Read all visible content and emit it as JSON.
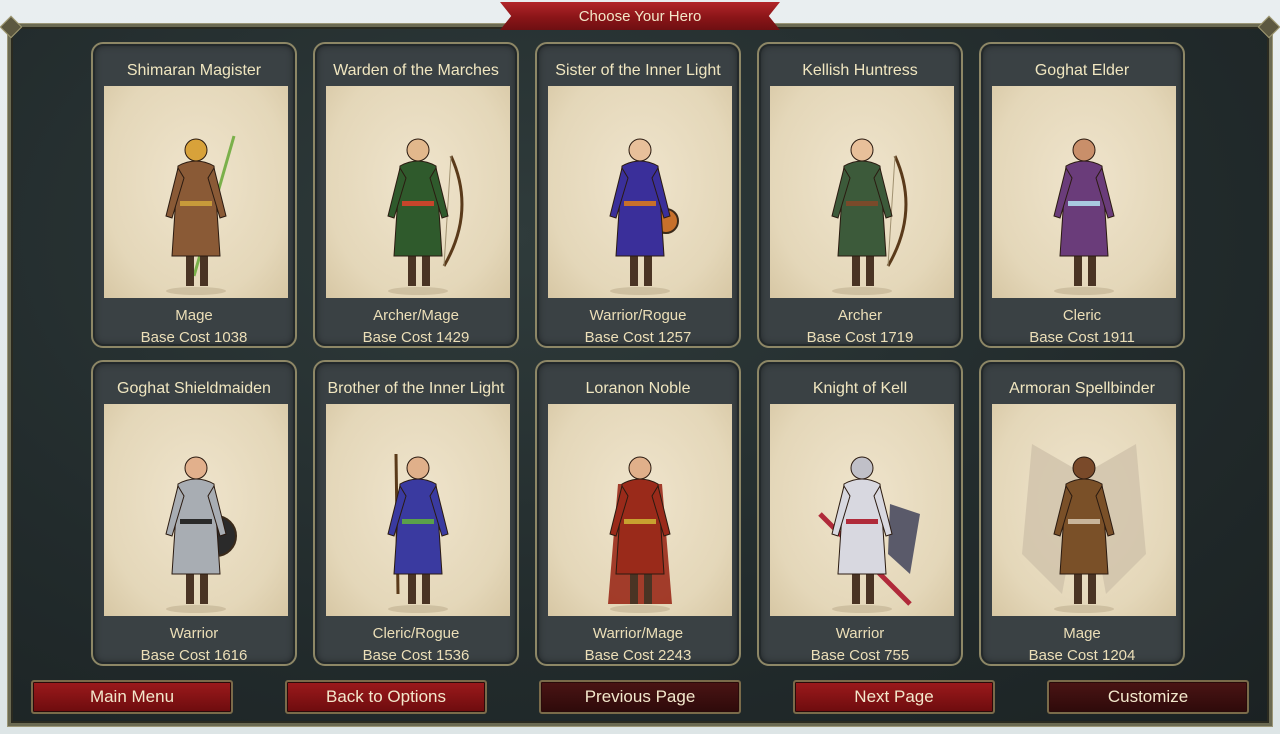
{
  "header": {
    "title": "Choose Your Hero"
  },
  "heroes": [
    {
      "name": "Shimaran Magister",
      "class": "Mage",
      "cost": "Base Cost 1038",
      "robe": "#8a5a36",
      "accent": "#c79a3a",
      "skin": "#d8a23a"
    },
    {
      "name": "Warden of the Marches",
      "class": "Archer/Mage",
      "cost": "Base Cost 1429",
      "robe": "#2f5a2c",
      "accent": "#c6452b",
      "skin": "#e2b88c"
    },
    {
      "name": "Sister of the Inner Light",
      "class": "Warrior/Rogue",
      "cost": "Base Cost 1257",
      "robe": "#3a2f9a",
      "accent": "#c7702b",
      "skin": "#e8c09a"
    },
    {
      "name": "Kellish Huntress",
      "class": "Archer",
      "cost": "Base Cost 1719",
      "robe": "#3c5a3a",
      "accent": "#7a4a2a",
      "skin": "#e8c09a"
    },
    {
      "name": "Goghat Elder",
      "class": "Cleric",
      "cost": "Base Cost 1911",
      "robe": "#6a3c7a",
      "accent": "#a9c9e0",
      "skin": "#c98f6a"
    },
    {
      "name": "Goghat Shieldmaiden",
      "class": "Warrior",
      "cost": "Base Cost 1616",
      "robe": "#a8adb3",
      "accent": "#2a2a2a",
      "skin": "#e2b08c"
    },
    {
      "name": "Brother of the Inner Light",
      "class": "Cleric/Rogue",
      "cost": "Base Cost 1536",
      "robe": "#3a3aa0",
      "accent": "#5aa04a",
      "skin": "#e0b08a"
    },
    {
      "name": "Loranon Noble",
      "class": "Warrior/Mage",
      "cost": "Base Cost 2243",
      "robe": "#9a2a1a",
      "accent": "#c8a030",
      "skin": "#e0b08a"
    },
    {
      "name": "Knight of Kell",
      "class": "Warrior",
      "cost": "Base Cost 755",
      "robe": "#d8d8e0",
      "accent": "#b02a3a",
      "skin": "#c0c0c8"
    },
    {
      "name": "Armoran Spellbinder",
      "class": "Mage",
      "cost": "Base Cost 1204",
      "robe": "#7a5028",
      "accent": "#c8b49a",
      "skin": "#7a4a2a"
    }
  ],
  "buttons": {
    "main_menu": "Main Menu",
    "back_to_options": "Back to Options",
    "previous_page": "Previous Page",
    "next_page": "Next Page",
    "customize": "Customize"
  }
}
